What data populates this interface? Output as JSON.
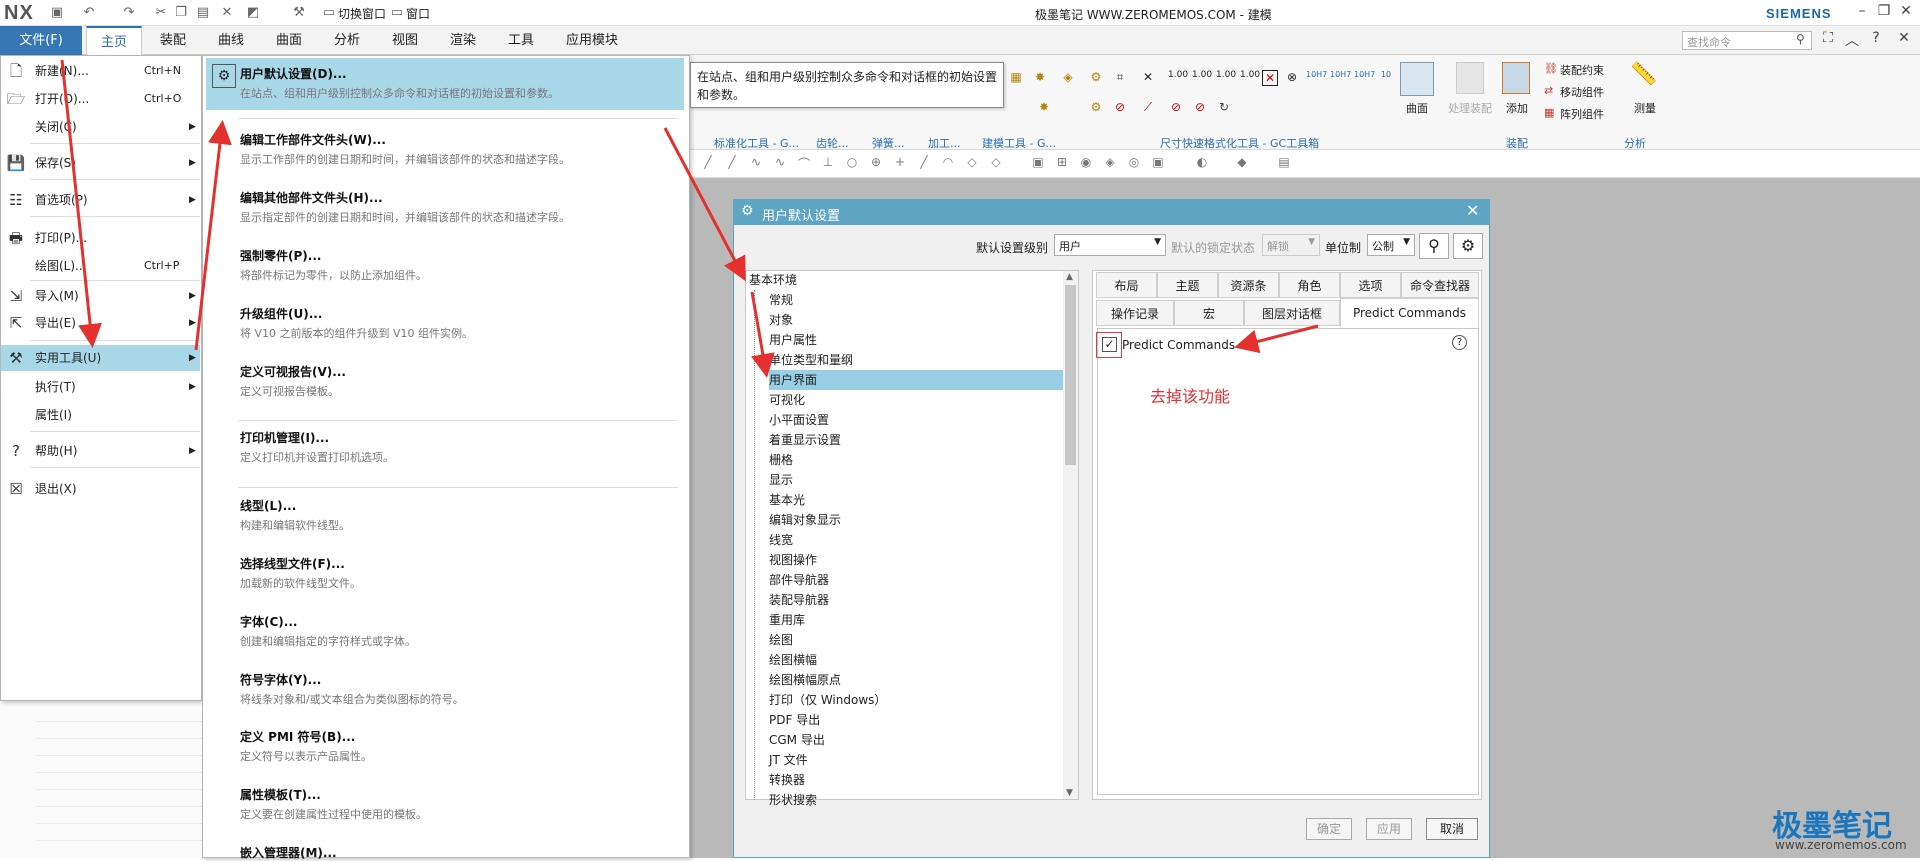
{
  "app": {
    "logo": "NX",
    "title": "极墨笔记 WWW.ZEROMEMOS.COM - 建模",
    "brand": "SIEMENS",
    "quick_access": {
      "switch_window": "切换窗口",
      "window": "窗口"
    }
  },
  "ribbon": {
    "file_tab": "文件(F)",
    "tabs": [
      "主页",
      "装配",
      "曲线",
      "曲面",
      "分析",
      "视图",
      "渲染",
      "工具",
      "应用模块"
    ],
    "search_placeholder": "查找命令",
    "groups": [
      "标准化工具 - G...",
      "齿轮...",
      "弹簧...",
      "加工...",
      "建模工具 - G...",
      "尺寸快速格式化工具 - GC工具箱",
      "装配",
      "分析"
    ],
    "big_buttons": [
      "曲面",
      "处理装配",
      "添加",
      "测量"
    ],
    "assembly_items": [
      "装配约束",
      "移动组件",
      "阵列组件"
    ]
  },
  "file_menu": {
    "items": [
      {
        "icon": "new-icon",
        "label": "新建(N)...",
        "shortcut": "Ctrl+N",
        "arrow": ""
      },
      {
        "icon": "open-icon",
        "label": "打开(O)...",
        "shortcut": "Ctrl+O",
        "arrow": ""
      },
      {
        "icon": "",
        "label": "关闭(C)",
        "shortcut": "",
        "arrow": "▶"
      },
      {
        "icon": "save-icon",
        "label": "保存(S)",
        "shortcut": "",
        "arrow": "▶"
      },
      {
        "icon": "preferences-icon",
        "label": "首选项(P)",
        "shortcut": "",
        "arrow": "▶"
      },
      {
        "icon": "print-icon",
        "label": "打印(P)...",
        "shortcut": "",
        "arrow": ""
      },
      {
        "icon": "",
        "label": "绘图(L)...",
        "shortcut": "Ctrl+P",
        "arrow": ""
      },
      {
        "icon": "import-icon",
        "label": "导入(M)",
        "shortcut": "",
        "arrow": "▶"
      },
      {
        "icon": "export-icon",
        "label": "导出(E)",
        "shortcut": "",
        "arrow": "▶"
      },
      {
        "icon": "utilities-icon",
        "label": "实用工具(U)",
        "shortcut": "",
        "arrow": "▶"
      },
      {
        "icon": "",
        "label": "执行(T)",
        "shortcut": "",
        "arrow": "▶"
      },
      {
        "icon": "",
        "label": "属性(I)",
        "shortcut": "",
        "arrow": ""
      },
      {
        "icon": "help-icon",
        "label": "帮助(H)",
        "shortcut": "",
        "arrow": "▶"
      },
      {
        "icon": "exit-icon",
        "label": "退出(X)",
        "shortcut": "",
        "arrow": ""
      }
    ]
  },
  "submenu": {
    "items": [
      {
        "title": "用户默认设置(D)...",
        "desc": "在站点、组和用户级别控制众多命令和对话框的初始设置和参数。"
      },
      {
        "title": "编辑工作部件文件头(W)...",
        "desc": "显示工作部件的创建日期和时间，并编辑该部件的状态和描述字段。"
      },
      {
        "title": "编辑其他部件文件头(H)...",
        "desc": "显示指定部件的创建日期和时间，并编辑该部件的状态和描述字段。"
      },
      {
        "title": "强制零件(P)...",
        "desc": "将部件标记为零件，以防止添加组件。"
      },
      {
        "title": "升级组件(U)...",
        "desc": "将 V10 之前版本的组件升级到 V10 组件实例。"
      },
      {
        "title": "定义可视报告(V)...",
        "desc": "定义可视报告模板。"
      },
      {
        "title": "打印机管理(I)...",
        "desc": "定义打印机并设置打印机选项。"
      },
      {
        "title": "线型(L)...",
        "desc": "构建和编辑软件线型。"
      },
      {
        "title": "选择线型文件(F)...",
        "desc": "加载新的软件线型文件。"
      },
      {
        "title": "字体(C)...",
        "desc": "创建和编辑指定的字符样式或字体。"
      },
      {
        "title": "符号字体(Y)...",
        "desc": "将线条对象和/或文本组合为类似图标的符号。"
      },
      {
        "title": "定义 PMI 符号(B)...",
        "desc": "定义符号以表示产品属性。"
      },
      {
        "title": "属性模板(T)...",
        "desc": "定义要在创建属性过程中使用的模板。"
      },
      {
        "title": "嵌入管理器(M)...",
        "desc": ""
      }
    ]
  },
  "tooltip": "在站点、组和用户级别控制众多命令和对话框的初始设置和参数。",
  "dialog": {
    "title": "用户默认设置",
    "level_label": "默认设置级别",
    "level_value": "用户",
    "lock_label": "默认的锁定状态",
    "lock_value": "解锁",
    "unit_label": "单位制",
    "unit_value": "公制",
    "tree_root": "基本环境",
    "tree_items": [
      "常规",
      "对象",
      "用户属性",
      "单位类型和量纲",
      "用户界面",
      "可视化",
      "小平面设置",
      "着重显示设置",
      "栅格",
      "显示",
      "基本光",
      "编辑对象显示",
      "线宽",
      "视图操作",
      "部件导航器",
      "装配导航器",
      "重用库",
      "绘图",
      "绘图横幅",
      "绘图横幅原点",
      "打印（仅 Windows）",
      "PDF 导出",
      "CGM 导出",
      "JT 文件",
      "转换器",
      "形状搜索"
    ],
    "selected_item": "用户界面",
    "tabs_row1": [
      "布局",
      "主题",
      "资源条",
      "角色",
      "选项",
      "命令查找器"
    ],
    "tabs_row2": [
      "操作记录",
      "宏",
      "图层对话框",
      "Predict Commands"
    ],
    "active_tab": "Predict Commands",
    "checkbox_label": "Predict Commands",
    "checkbox_checked": true,
    "annotation": "去掉该功能",
    "ok": "确定",
    "apply": "应用",
    "cancel": "取消"
  },
  "watermark": {
    "title": "极墨笔记",
    "url": "www.zeromemos.com"
  },
  "colors": {
    "accent": "#3877b6",
    "dialog_header": "#5ea5c4",
    "selection": "#99cfe6",
    "annotation_red": "#e53030"
  }
}
